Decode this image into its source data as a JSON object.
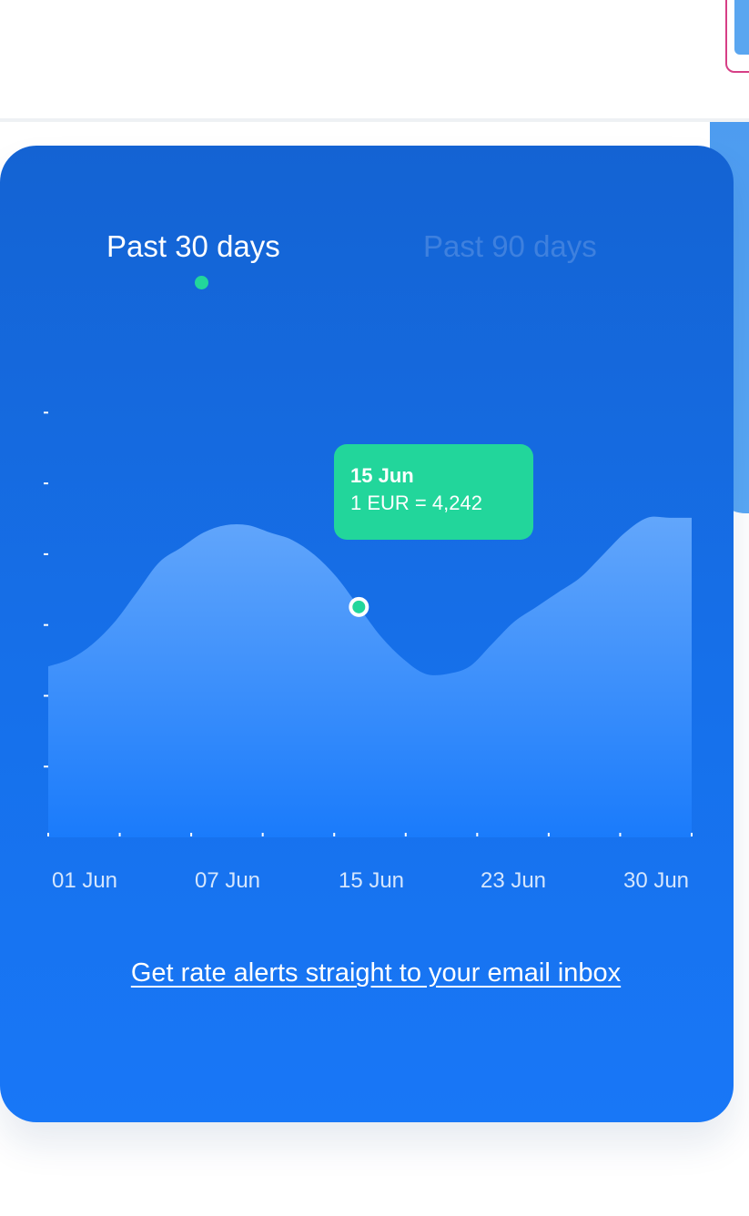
{
  "colors": {
    "card_top": "#1463d3",
    "card_bottom": "#1877f7",
    "area_top": "#62a6fb",
    "area_bottom": "#1a7bfb",
    "accent_green": "#22d69b",
    "tab_active": "#ffffff",
    "corner_border": "#d63f86"
  },
  "tabs": {
    "active": "Past 30 days",
    "inactive": "Past 90 days"
  },
  "tooltip": {
    "date": "15 Jun",
    "rate": "1 EUR = 4,242"
  },
  "alert_link": "Get rate alerts straight to your email inbox",
  "chart_data": {
    "type": "area",
    "x": [
      1,
      2,
      3,
      4,
      5,
      6,
      7,
      8,
      9,
      10,
      11,
      12,
      13,
      14,
      15,
      16,
      17,
      18,
      19,
      20,
      21,
      22,
      23,
      24,
      25,
      26,
      27,
      28,
      29,
      30
    ],
    "x_tick_labels": [
      "01 Jun",
      "07 Jun",
      "15 Jun",
      "23 Jun",
      "30 Jun"
    ],
    "x_tick_positions": [
      1,
      7,
      15,
      23,
      30
    ],
    "series": [
      {
        "values": [
          2.3,
          2.4,
          2.6,
          2.9,
          3.3,
          3.7,
          3.9,
          4.1,
          4.2,
          4.2,
          4.1,
          4.0,
          3.8,
          3.5,
          3.1,
          2.7,
          2.4,
          2.2,
          2.2,
          2.3,
          2.6,
          2.9,
          3.1,
          3.3,
          3.5,
          3.8,
          4.1,
          4.3,
          4.3,
          4.3
        ]
      }
    ],
    "ylim": [
      0,
      6
    ],
    "y_tick_count": 6,
    "highlight": {
      "x": 15,
      "label": "15 Jun",
      "value_text": "1 EUR = 4,242"
    },
    "grid": false
  }
}
